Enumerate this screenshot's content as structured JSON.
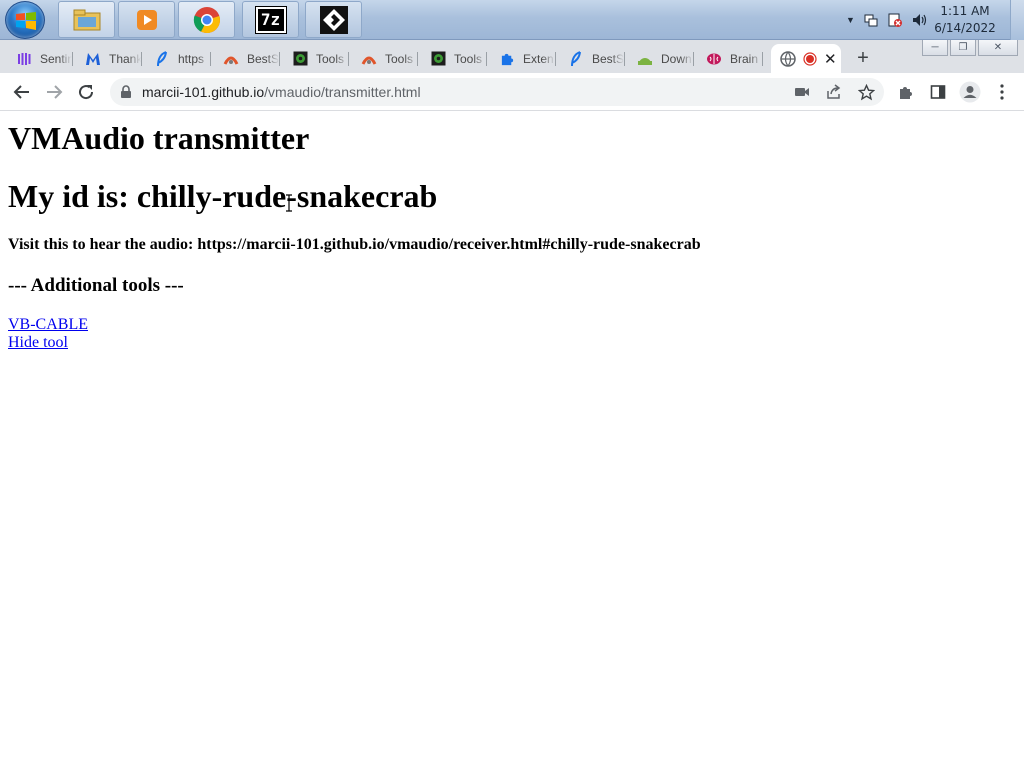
{
  "taskbar": {
    "clock_time": "1:11 AM",
    "clock_date": "6/14/2022",
    "apps": [
      "file-explorer",
      "media-player",
      "chrome",
      "7zip",
      "cursor-app"
    ],
    "seven_zip_label": "7z"
  },
  "tabs": [
    {
      "title": "Sentinel",
      "icon": "sentinel-icon",
      "color": "#7b3fe4"
    },
    {
      "title": "Thanks",
      "icon": "malwarebytes-icon",
      "color": "#1c5fd8"
    },
    {
      "title": "https",
      "icon": "feather-icon",
      "color": "#1a73e8"
    },
    {
      "title": "BestS",
      "icon": "besties-icon",
      "color": "#e0552b"
    },
    {
      "title": "Tools",
      "icon": "gear-icon",
      "color": "#3d9b35"
    },
    {
      "title": "Tools",
      "icon": "besties-icon",
      "color": "#e0552b"
    },
    {
      "title": "Tools",
      "icon": "gear-icon",
      "color": "#3d9b35"
    },
    {
      "title": "Exten",
      "icon": "puzzle-icon",
      "color": "#1a73e8"
    },
    {
      "title": "BestS",
      "icon": "feather-icon",
      "color": "#1a73e8"
    },
    {
      "title": "Down",
      "icon": "android-icon",
      "color": "#7cb342"
    },
    {
      "title": "Brain",
      "icon": "brain-icon",
      "color": "#c2185b"
    }
  ],
  "active_tab": {
    "icon": "globe-icon",
    "recording_icon": "record-icon"
  },
  "address_bar": {
    "host": "marcii-101.github.io",
    "path": "/vmaudio/transmitter.html"
  },
  "page": {
    "title": "VMAudio transmitter",
    "id_heading": "My id is: chilly-rude-snakecrab",
    "visit_text": "Visit this to hear the audio: https://marcii-101.github.io/vmaudio/receiver.html#chilly-rude-snakecrab",
    "tools_heading": "--- Additional tools ---",
    "links": [
      "VB-CABLE",
      "Hide tool"
    ]
  },
  "colors": {
    "link": "#0000ee",
    "tabstrip": "#dee1e6",
    "omnibox": "#f1f3f4"
  }
}
